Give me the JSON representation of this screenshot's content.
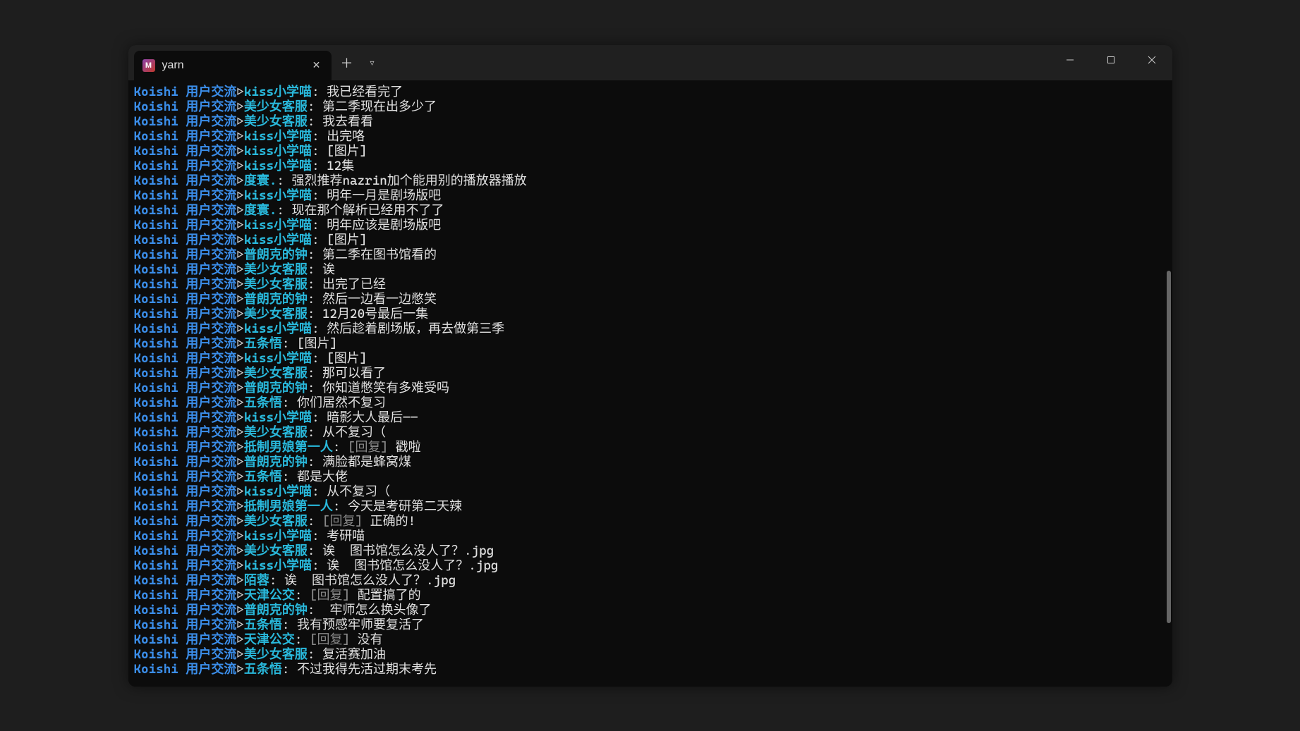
{
  "window": {
    "tab_title": "yarn",
    "tab_icon_letter": "M"
  },
  "terminal": {
    "channel_prefix": "Koishi 用户交流",
    "arrow": "▷",
    "separator": ": ",
    "reply_tag": "[回复]",
    "lines": [
      {
        "user": "kiss小学喵",
        "msg": "我已经看完了"
      },
      {
        "user": "美少女客服",
        "msg": "第二季现在出多少了"
      },
      {
        "user": "美少女客服",
        "msg": "我去看看"
      },
      {
        "user": "kiss小学喵",
        "msg": "出完咯"
      },
      {
        "user": "kiss小学喵",
        "msg": "[图片]"
      },
      {
        "user": "kiss小学喵",
        "msg": "12集"
      },
      {
        "user": "度寰.",
        "msg": "强烈推荐nazrin加个能用别的播放器播放"
      },
      {
        "user": "kiss小学喵",
        "msg": "明年一月是剧场版吧"
      },
      {
        "user": "度寰.",
        "msg": "现在那个解析已经用不了了"
      },
      {
        "user": "kiss小学喵",
        "msg": "明年应该是剧场版吧"
      },
      {
        "user": "kiss小学喵",
        "msg": "[图片]"
      },
      {
        "user": "普朗克的钟",
        "msg": "第二季在图书馆看的"
      },
      {
        "user": "美少女客服",
        "msg": "诶"
      },
      {
        "user": "美少女客服",
        "msg": "出完了已经"
      },
      {
        "user": "普朗克的钟",
        "msg": "然后一边看一边憋笑"
      },
      {
        "user": "美少女客服",
        "msg": "12月20号最后一集"
      },
      {
        "user": "kiss小学喵",
        "msg": "然后趁着剧场版，再去做第三季"
      },
      {
        "user": "五条悟",
        "msg": "[图片]"
      },
      {
        "user": "kiss小学喵",
        "msg": "[图片]"
      },
      {
        "user": "美少女客服",
        "msg": "那可以看了"
      },
      {
        "user": "普朗克的钟",
        "msg": "你知道憋笑有多难受吗"
      },
      {
        "user": "五条悟",
        "msg": "你们居然不复习"
      },
      {
        "user": "kiss小学喵",
        "msg": "暗影大人最后——"
      },
      {
        "user": "美少女客服",
        "msg": "从不复习（"
      },
      {
        "user": "抵制男娘第一人",
        "reply": true,
        "msg": "戳啦"
      },
      {
        "user": "普朗克的钟",
        "msg": "满脸都是蜂窝煤"
      },
      {
        "user": "五条悟",
        "msg": "都是大佬"
      },
      {
        "user": "kiss小学喵",
        "msg": "从不复习（"
      },
      {
        "user": "抵制男娘第一人",
        "msg": "今天是考研第二天辣"
      },
      {
        "user": "美少女客服",
        "reply": true,
        "msg": "正确的!"
      },
      {
        "user": "kiss小学喵",
        "msg": "考研喵"
      },
      {
        "user": "美少女客服",
        "msg": "诶  图书馆怎么没人了？.jpg"
      },
      {
        "user": "kiss小学喵",
        "msg": "诶  图书馆怎么没人了？.jpg"
      },
      {
        "user": "陌蓉",
        "msg": "诶  图书馆怎么没人了？.jpg"
      },
      {
        "user": "天津公交",
        "reply": true,
        "msg": "配置搞了的"
      },
      {
        "user": "普朗克的钟",
        "msg": " 牢师怎么换头像了"
      },
      {
        "user": "五条悟",
        "msg": "我有预感牢师要复活了"
      },
      {
        "user": "天津公交",
        "reply": true,
        "msg": "没有"
      },
      {
        "user": "美少女客服",
        "msg": "复活赛加油"
      },
      {
        "user": "五条悟",
        "msg": "不过我得先活过期末考先"
      }
    ]
  }
}
